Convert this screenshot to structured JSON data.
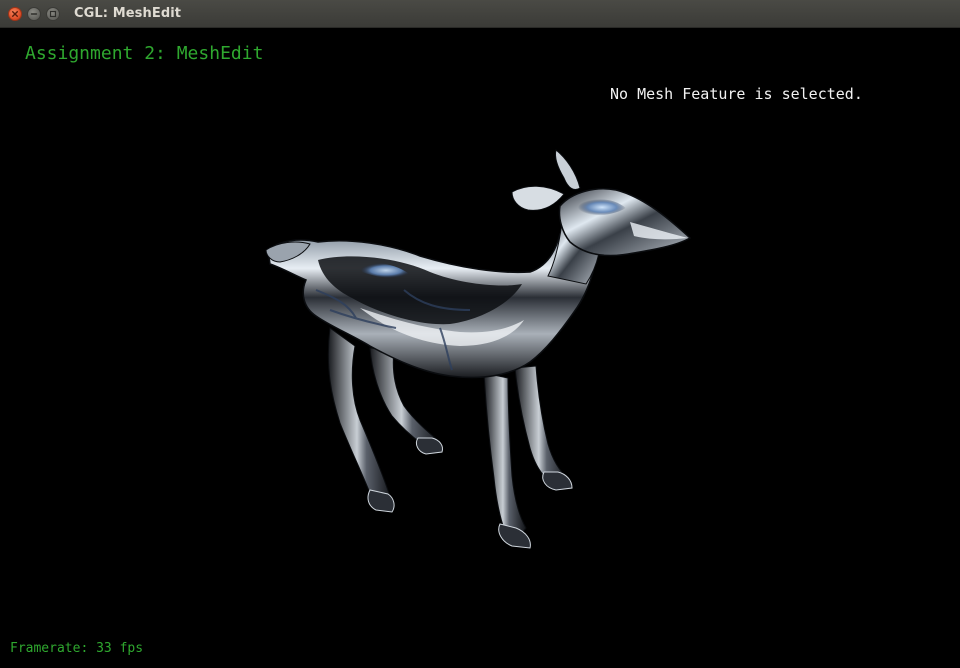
{
  "window": {
    "title": "CGL: MeshEdit"
  },
  "viewport": {
    "heading": "Assignment 2: MeshEdit",
    "status": "No Mesh Feature is selected.",
    "framerate_label": "Framerate:",
    "framerate_value": "33",
    "framerate_unit": "fps"
  },
  "model": {
    "name": "deer-mesh",
    "material": "chrome"
  },
  "colors": {
    "heading": "#2fa82f",
    "status": "#f2f2f2",
    "background": "#000000",
    "titlebar": "#3b3b37"
  }
}
